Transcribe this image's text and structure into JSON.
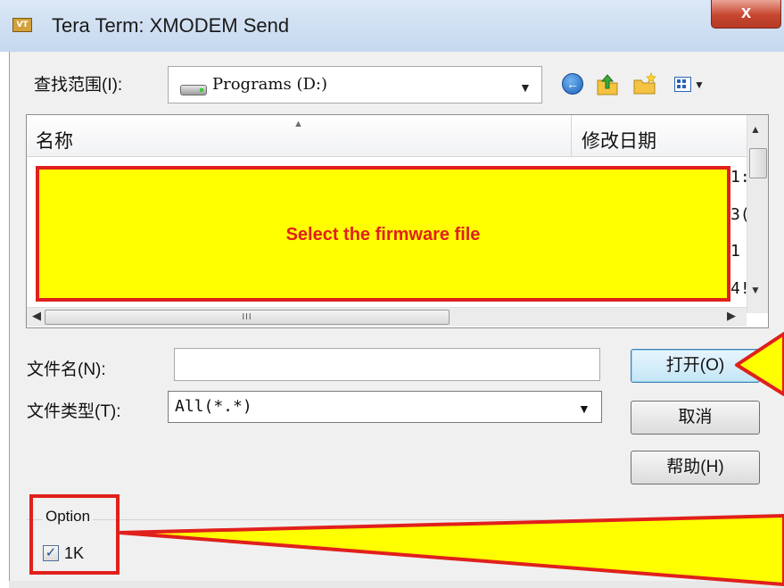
{
  "window": {
    "icon_text": "VT",
    "title": "Tera Term: XMODEM Send",
    "close_glyph": "x"
  },
  "look_in": {
    "label": "查找范围(I):",
    "value": "Programs (D:)"
  },
  "toolbar": {
    "back_icon": "back-arrow-icon",
    "up_icon": "up-folder-icon",
    "new_folder_icon": "new-folder-icon",
    "view_icon": "view-menu-icon"
  },
  "file_list": {
    "columns": [
      "名称",
      "修改日期"
    ],
    "row_fragments": [
      "1:",
      "3(",
      "1",
      "4!"
    ]
  },
  "annotation": {
    "text": "Select the firmware file",
    "fill_color": "#ffff00",
    "border_color": "#e0201c"
  },
  "scrollbar": {
    "h_thumb_grip": "III"
  },
  "file_name": {
    "label": "文件名(N):",
    "value": "",
    "placeholder": ""
  },
  "file_type": {
    "label": "文件类型(T):",
    "value": "All(*.*)"
  },
  "buttons": {
    "open": "打开(O)",
    "cancel": "取消",
    "help": "帮助(H)"
  },
  "option": {
    "group_label": "Option",
    "checkbox_label": "1K",
    "checked": true
  }
}
